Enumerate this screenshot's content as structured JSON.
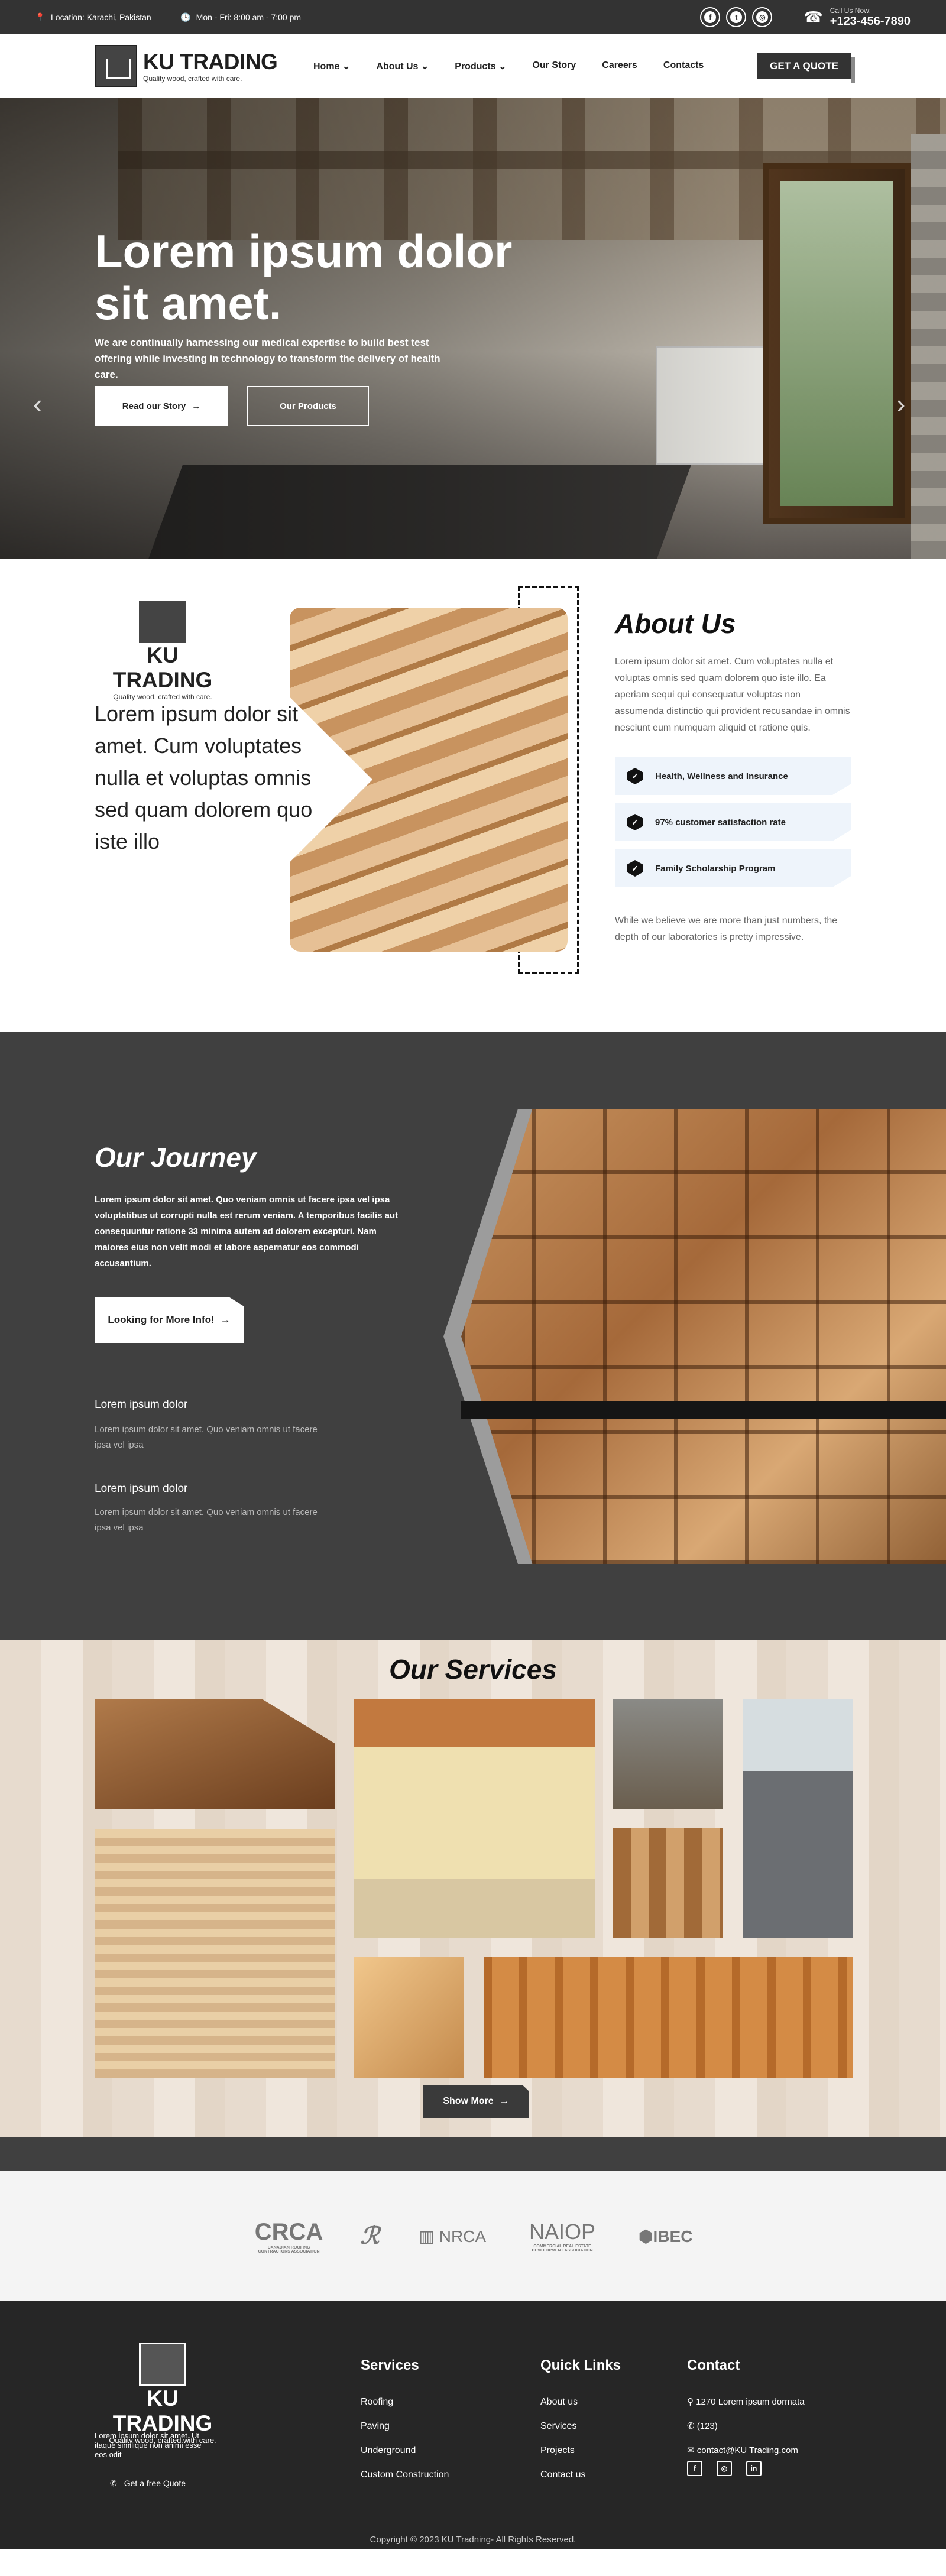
{
  "topbar": {
    "location": "Location: Karachi, Pakistan",
    "hours": "Mon - Fri: 8:00 am - 7:00 pm",
    "call_label": "Call Us Now:",
    "phone": "+123-456-7890"
  },
  "brand": {
    "name": "KU TRADING",
    "tagline": "Quality wood, crafted with care."
  },
  "nav": {
    "items": [
      "Home",
      "About Us",
      "Products",
      "Our Story",
      "Careers",
      "Contacts"
    ],
    "cta": "GET A QUOTE"
  },
  "hero": {
    "title": "Lorem ipsum dolor sit amet.",
    "text": "We are continually harnessing our medical expertise to build best test offering while investing in technology to transform the delivery of health care.",
    "btn_primary": "Read our Story",
    "btn_secondary": "Our Products"
  },
  "about": {
    "lead": "Lorem ipsum dolor sit amet. Cum voluptates nulla et voluptas omnis sed quam dolorem quo iste illo",
    "title": "About Us",
    "desc": "Lorem ipsum dolor sit amet. Cum voluptates nulla et voluptas omnis sed quam dolorem quo iste illo. Ea aperiam sequi qui consequatur voluptas non assumenda distinctio qui provident recusandae in omnis nesciunt eum numquam aliquid et ratione quis.",
    "features": [
      "Health, Wellness and Insurance",
      "97% customer satisfaction rate",
      "Family Scholarship Program"
    ],
    "note": "While we believe we are more than just numbers, the depth of our laboratories is pretty impressive."
  },
  "journey": {
    "title": "Our Journey",
    "text": "Lorem ipsum dolor sit amet. Quo veniam omnis ut facere ipsa vel ipsa voluptatibus ut corrupti nulla est rerum veniam. A temporibus facilis aut consequuntur ratione 33 minima autem ad dolorem excepturi. Nam maiores eius non velit modi et labore aspernatur eos commodi accusantium.",
    "button": "Looking for More Info!",
    "items": [
      {
        "heading": "Lorem ipsum dolor",
        "text": "Lorem ipsum dolor sit amet. Quo veniam omnis ut facere ipsa vel ipsa"
      },
      {
        "heading": "Lorem ipsum dolor",
        "text": "Lorem ipsum dolor sit amet. Quo veniam omnis ut facere ipsa vel ipsa"
      }
    ]
  },
  "services": {
    "title": "Our Services",
    "button": "Show More"
  },
  "partners": [
    {
      "name": "CRCA",
      "sub": "CANADIAN ROOFING CONTRACTORS ASSOCIATION"
    },
    {
      "name": "NRCA",
      "sub": ""
    },
    {
      "name": "NAIOP",
      "sub": "COMMERCIAL REAL ESTATE DEVELOPMENT ASSOCIATION"
    },
    {
      "name": "IBEC",
      "sub": ""
    }
  ],
  "footer": {
    "desc": "Lorem ipsum dolor sit amet. Ut itaque similique non animi esse eos odit",
    "quote": "Get a free Quote",
    "services_title": "Services",
    "services": [
      "Roofing",
      "Paving",
      "Underground",
      "Custom Construction"
    ],
    "links_title": "Quick Links",
    "links": [
      "About us",
      "Services",
      "Projects",
      "Contact us"
    ],
    "contact_title": "Contact",
    "address": "1270 Lorem ipsum dormata",
    "phone": "(123)",
    "email": "contact@KU Trading.com",
    "copyright": "Copyright © 2023 KU Tradning- All Rights Reserved."
  },
  "colors": {
    "dark": "#333333",
    "section": "#404040",
    "footer": "#262626",
    "accent_light": "#eef4fb"
  }
}
